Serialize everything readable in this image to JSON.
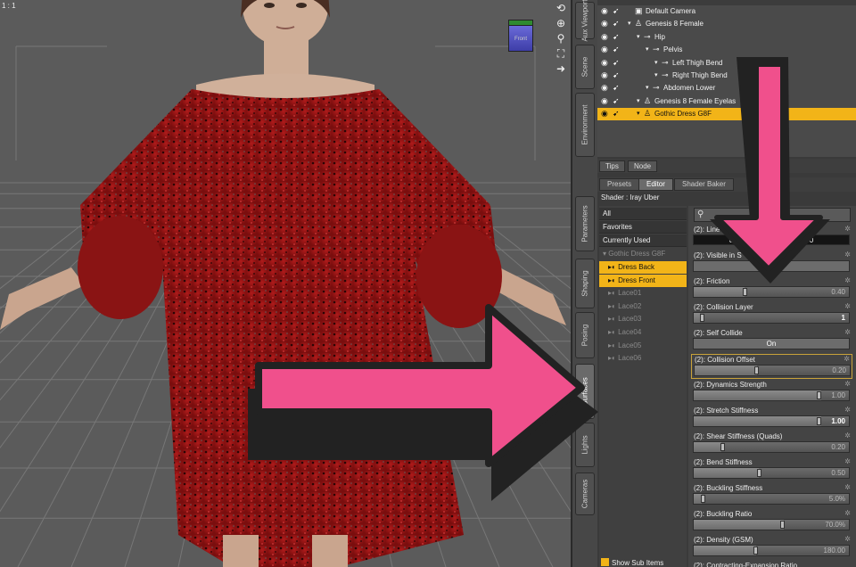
{
  "viewport": {
    "ratio_label": "1 : 1",
    "nav_cube_label": "Front",
    "tools": [
      {
        "icon": "camera-rotate-icon",
        "glyph": "⟲"
      },
      {
        "icon": "orbit-icon",
        "glyph": "⊕"
      },
      {
        "icon": "zoom-icon",
        "glyph": "⚲"
      },
      {
        "icon": "frame-icon",
        "glyph": "⛶"
      },
      {
        "icon": "reset-view-icon",
        "glyph": "➜"
      }
    ]
  },
  "side_tabs": [
    "Aux Viewport",
    "Scene",
    "Environment",
    "Parameters",
    "Shaping",
    "Posing",
    "Surfaces",
    "Lights",
    "Cameras"
  ],
  "scene": {
    "rows": [
      {
        "label": "Default Camera",
        "icon": "camera-icon",
        "indent": 0,
        "arrow": false,
        "selected": false
      },
      {
        "label": "Genesis 8 Female",
        "icon": "figure-icon",
        "indent": 0,
        "arrow": true,
        "selected": false
      },
      {
        "label": "Hip",
        "icon": "bone-icon",
        "indent": 1,
        "arrow": true,
        "selected": false
      },
      {
        "label": "Pelvis",
        "icon": "bone-icon",
        "indent": 2,
        "arrow": true,
        "selected": false
      },
      {
        "label": "Left Thigh Bend",
        "icon": "bone-icon",
        "indent": 3,
        "arrow": true,
        "selected": false
      },
      {
        "label": "Right Thigh Bend",
        "icon": "bone-icon",
        "indent": 3,
        "arrow": true,
        "selected": false
      },
      {
        "label": "Abdomen Lower",
        "icon": "bone-icon",
        "indent": 2,
        "arrow": true,
        "selected": false
      },
      {
        "label": "Genesis 8 Female Eyelas",
        "icon": "figure-icon",
        "indent": 1,
        "arrow": true,
        "selected": false
      },
      {
        "label": "Gothic Dress G8F",
        "icon": "figure-icon",
        "indent": 1,
        "arrow": true,
        "selected": true
      }
    ]
  },
  "lower_tabs": [
    "Tips",
    "Node"
  ],
  "sub_tabs": [
    "Presets",
    "Editor",
    "Shader Baker"
  ],
  "active_sub_tab": "Editor",
  "shader_label": "Shader : Iray Uber",
  "surfaces": {
    "categories": [
      "All",
      "Favorites",
      "Currently Used"
    ],
    "group": "Gothic Dress G8F",
    "items": [
      {
        "label": "Dress Back",
        "highlighted": true
      },
      {
        "label": "Dress Front",
        "highlighted": true
      },
      {
        "label": "Lace01",
        "highlighted": false
      },
      {
        "label": "Lace02",
        "highlighted": false
      },
      {
        "label": "Lace03",
        "highlighted": false
      },
      {
        "label": "Lace04",
        "highlighted": false
      },
      {
        "label": "Lace05",
        "highlighted": false
      },
      {
        "label": "Lace06",
        "highlighted": false
      }
    ],
    "show_sub_items": "Show Sub Items"
  },
  "properties": {
    "line_prop": {
      "name": "(2): Line",
      "left": "0",
      "right": "0"
    },
    "visible_prop": {
      "name": "(2): Visible in S"
    },
    "sliders": [
      {
        "name": "(2): Friction",
        "value": "0.40",
        "fraction": 0.33,
        "bright": false,
        "focused": false
      },
      {
        "name": "(2): Collision Layer",
        "value": "1",
        "fraction": 0.04,
        "bright": true,
        "focused": false
      },
      {
        "name": "(2): Collision Offset",
        "value": "0.20",
        "fraction": 0.4,
        "bright": false,
        "focused": true
      },
      {
        "name": "(2): Dynamics Strength",
        "value": "1.00",
        "fraction": 0.82,
        "bright": false,
        "focused": false
      },
      {
        "name": "(2): Stretch Stiffness",
        "value": "1.00",
        "fraction": 0.82,
        "bright": true,
        "focused": false
      },
      {
        "name": "(2): Shear Stiffness (Quads)",
        "value": "0.20",
        "fraction": 0.18,
        "bright": false,
        "focused": false
      },
      {
        "name": "(2): Bend Stiffness",
        "value": "0.50",
        "fraction": 0.42,
        "bright": false,
        "focused": false
      },
      {
        "name": "(2): Buckling Stiffness",
        "value": "5.0%",
        "fraction": 0.05,
        "bright": false,
        "focused": false
      },
      {
        "name": "(2): Buckling Ratio",
        "value": "70.0%",
        "fraction": 0.58,
        "bright": false,
        "focused": false
      },
      {
        "name": "(2): Density (GSM)",
        "value": "180.00",
        "fraction": 0.4,
        "bright": false,
        "focused": false
      }
    ],
    "self_collide": {
      "name": "(2): Self Collide",
      "value": "On"
    },
    "last_partial": "(2): Contracting-Expansion Ratio"
  }
}
